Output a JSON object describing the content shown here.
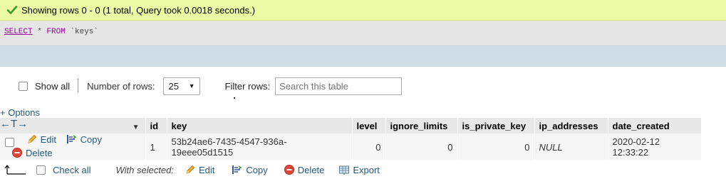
{
  "message": {
    "text": "Showing rows 0 - 0 (1 total, Query took 0.0018 seconds.)",
    "icon": "check-icon",
    "color": "#ebf8a4"
  },
  "sql": {
    "select": "SELECT",
    "star": " * ",
    "from": "FROM",
    "table": " `keys`"
  },
  "nav": {
    "show_all": "Show all",
    "number_of_rows_label": "Number of rows:",
    "rows_value": "25",
    "filter_label": "Filter rows:",
    "search_placeholder": "Search this table"
  },
  "options_label": "+ Options",
  "arrows": "←T→",
  "table": {
    "columns": [
      "id",
      "key",
      "level",
      "ignore_limits",
      "is_private_key",
      "ip_addresses",
      "date_created"
    ],
    "row": {
      "edit": "Edit",
      "copy": "Copy",
      "delete": "Delete",
      "id": "1",
      "key": "53b24ae6-7435-4547-936a-19eee05d1515",
      "level": "0",
      "ignore_limits": "0",
      "is_private_key": "0",
      "ip_addresses": "NULL",
      "date_created": "2020-02-12 12:33:22"
    }
  },
  "bottom": {
    "check_all": "Check all",
    "with_selected": "With selected:",
    "edit": "Edit",
    "copy": "Copy",
    "delete": "Delete",
    "export": "Export"
  }
}
